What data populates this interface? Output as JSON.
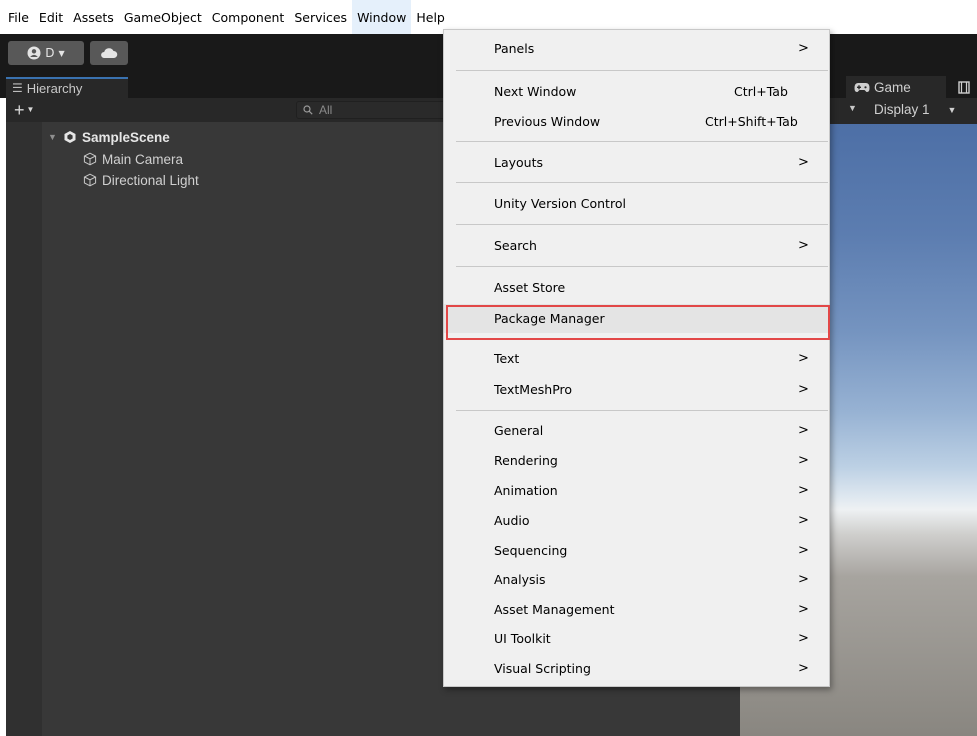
{
  "menubar": {
    "items": [
      "File",
      "Edit",
      "Assets",
      "GameObject",
      "Component",
      "Services",
      "Window",
      "Help"
    ]
  },
  "toolbar": {
    "account_label": "D"
  },
  "hierarchy": {
    "tab_label": "Hierarchy",
    "search_placeholder": "All",
    "scene_name": "SampleScene",
    "objects": [
      "Main Camera",
      "Directional Light"
    ]
  },
  "game_panel": {
    "tab_label": "Game",
    "display_label": "Display 1"
  },
  "window_menu": {
    "items": [
      {
        "label": "Panels",
        "submenu": true
      },
      {
        "label": "Next Window",
        "shortcut": "Ctrl+Tab"
      },
      {
        "label": "Previous Window",
        "shortcut": "Ctrl+Shift+Tab"
      },
      {
        "label": "Layouts",
        "submenu": true
      },
      {
        "label": "Unity Version Control"
      },
      {
        "label": "Search",
        "submenu": true
      },
      {
        "label": "Asset Store"
      },
      {
        "label": "Package Manager",
        "highlighted": true
      },
      {
        "label": "Text",
        "submenu": true
      },
      {
        "label": "TextMeshPro",
        "submenu": true
      },
      {
        "label": "General",
        "submenu": true
      },
      {
        "label": "Rendering",
        "submenu": true
      },
      {
        "label": "Animation",
        "submenu": true
      },
      {
        "label": "Audio",
        "submenu": true
      },
      {
        "label": "Sequencing",
        "submenu": true
      },
      {
        "label": "Analysis",
        "submenu": true
      },
      {
        "label": "Asset Management",
        "submenu": true
      },
      {
        "label": "UI Toolkit",
        "submenu": true
      },
      {
        "label": "Visual Scripting",
        "submenu": true
      }
    ],
    "submenu_glyph": ">"
  },
  "colors": {
    "highlight_box": "#e24747",
    "active_tab_accent": "#3a72b0"
  }
}
